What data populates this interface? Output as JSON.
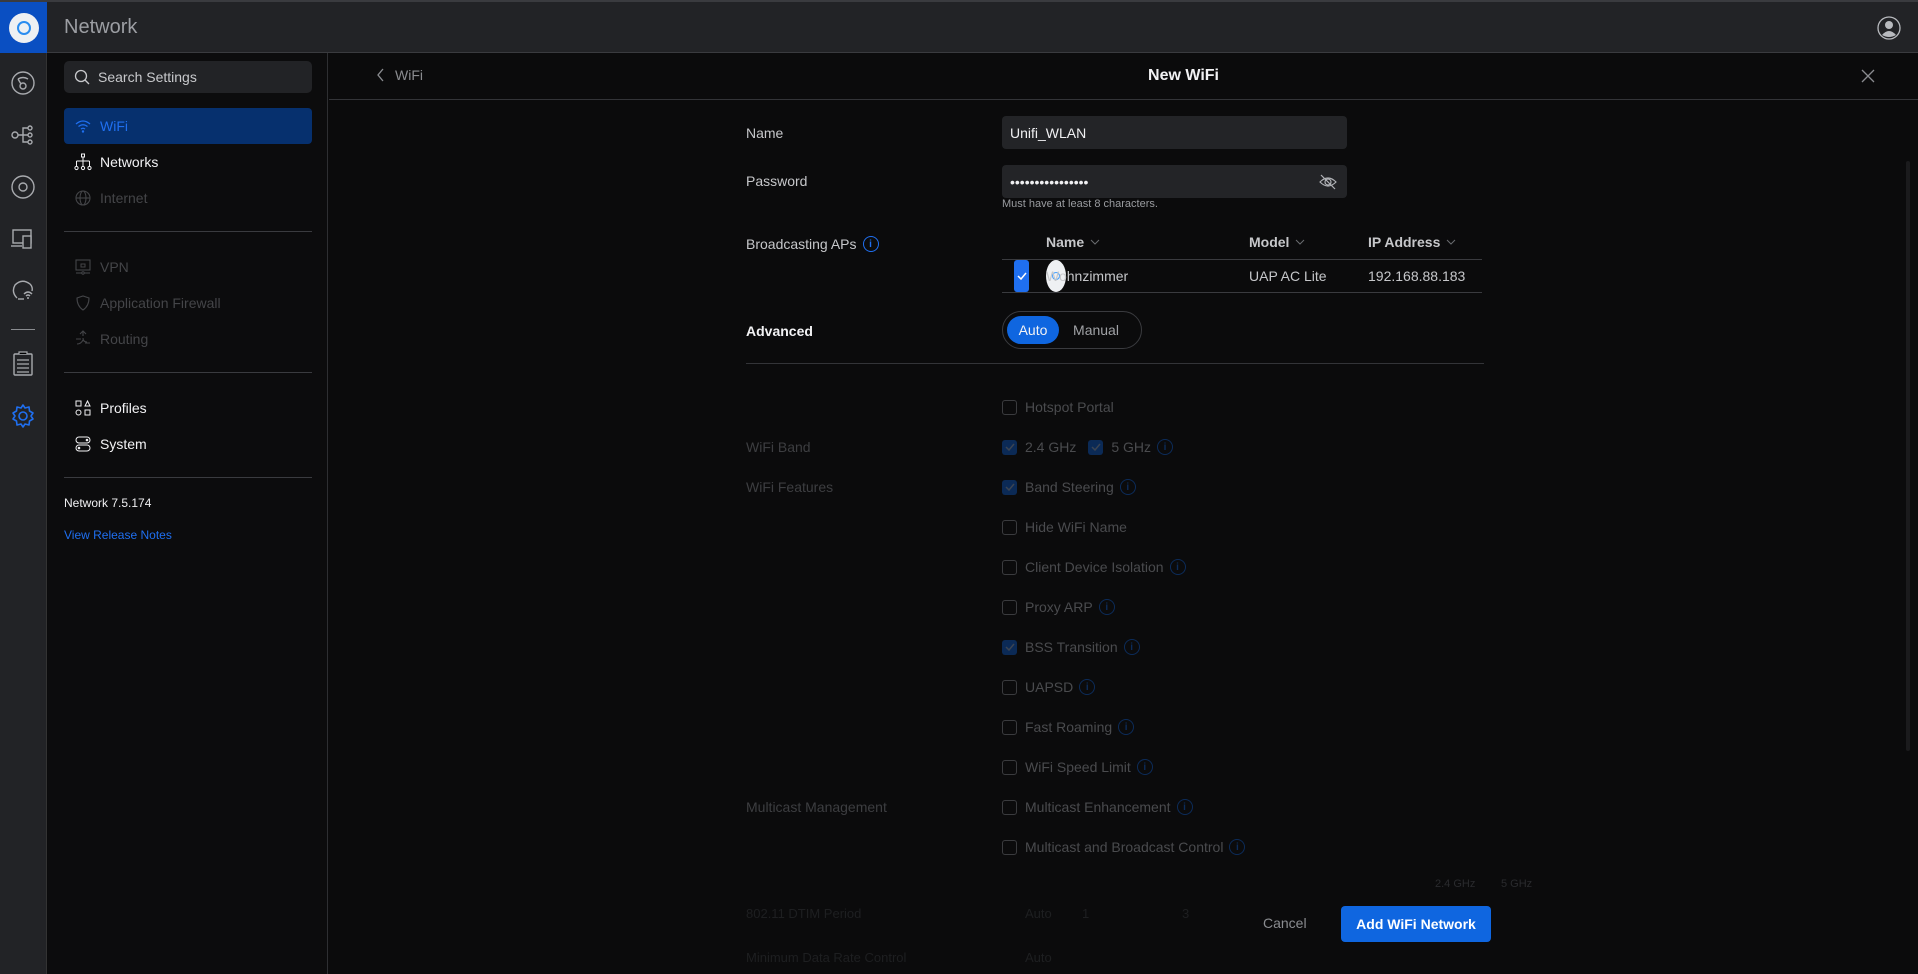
{
  "app": {
    "title": "Network"
  },
  "search": {
    "placeholder": "Search Settings"
  },
  "nav": {
    "items": [
      {
        "label": "WiFi",
        "state": "active"
      },
      {
        "label": "Networks",
        "state": "enabled"
      },
      {
        "label": "Internet",
        "state": "disabled"
      },
      {
        "label": "VPN",
        "state": "disabled"
      },
      {
        "label": "Application Firewall",
        "state": "disabled"
      },
      {
        "label": "Routing",
        "state": "disabled"
      },
      {
        "label": "Profiles",
        "state": "enabled"
      },
      {
        "label": "System",
        "state": "enabled"
      }
    ],
    "version": "Network 7.5.174",
    "release_notes": "View Release Notes"
  },
  "panel": {
    "back_label": "WiFi",
    "title": "New WiFi"
  },
  "form": {
    "name_label": "Name",
    "name_value": "Unifi_WLAN",
    "password_label": "Password",
    "password_value": "••••••••••••••••",
    "password_hint": "Must have at least 8 characters.",
    "aps_label": "Broadcasting APs",
    "ap_table": {
      "headers": [
        "Name",
        "Model",
        "IP Address"
      ],
      "rows": [
        {
          "checked": true,
          "name": "Wohnzimmer",
          "model": "UAP AC Lite",
          "ip": "192.168.88.183"
        }
      ]
    },
    "advanced_label": "Advanced",
    "advanced_options": [
      "Auto",
      "Manual"
    ],
    "advanced_selected": "Auto",
    "hotspot": {
      "label": "Hotspot Portal",
      "checked": false
    },
    "wifi_band_label": "WiFi Band",
    "bands": [
      {
        "label": "2.4 GHz",
        "checked": true
      },
      {
        "label": "5 GHz",
        "checked": true
      }
    ],
    "wifi_features_label": "WiFi Features",
    "features": [
      {
        "label": "Band Steering",
        "checked": true,
        "info": true
      },
      {
        "label": "Hide WiFi Name",
        "checked": false,
        "info": false
      },
      {
        "label": "Client Device Isolation",
        "checked": false,
        "info": true
      },
      {
        "label": "Proxy ARP",
        "checked": false,
        "info": true
      },
      {
        "label": "BSS Transition",
        "checked": true,
        "info": true
      },
      {
        "label": "UAPSD",
        "checked": false,
        "info": true
      },
      {
        "label": "Fast Roaming",
        "checked": false,
        "info": true
      },
      {
        "label": "WiFi Speed Limit",
        "checked": false,
        "info": true
      }
    ],
    "multicast_label": "Multicast Management",
    "multicast": [
      {
        "label": "Multicast Enhancement",
        "checked": false
      },
      {
        "label": "Multicast and Broadcast Control",
        "checked": false
      }
    ],
    "dtim": {
      "label": "802.11 DTIM Period",
      "auto_label": "Auto",
      "band_24_label": "2.4 GHz",
      "band_5_label": "5 GHz",
      "value_24": "1",
      "value_5": "3"
    },
    "min_data_rate": {
      "label": "Minimum Data Rate Control",
      "auto_label": "Auto"
    }
  },
  "footer": {
    "cancel": "Cancel",
    "submit": "Add WiFi Network"
  },
  "colors": {
    "accent": "#0f66e0",
    "active_nav_bg": "#06306e",
    "rail": "#222326"
  }
}
